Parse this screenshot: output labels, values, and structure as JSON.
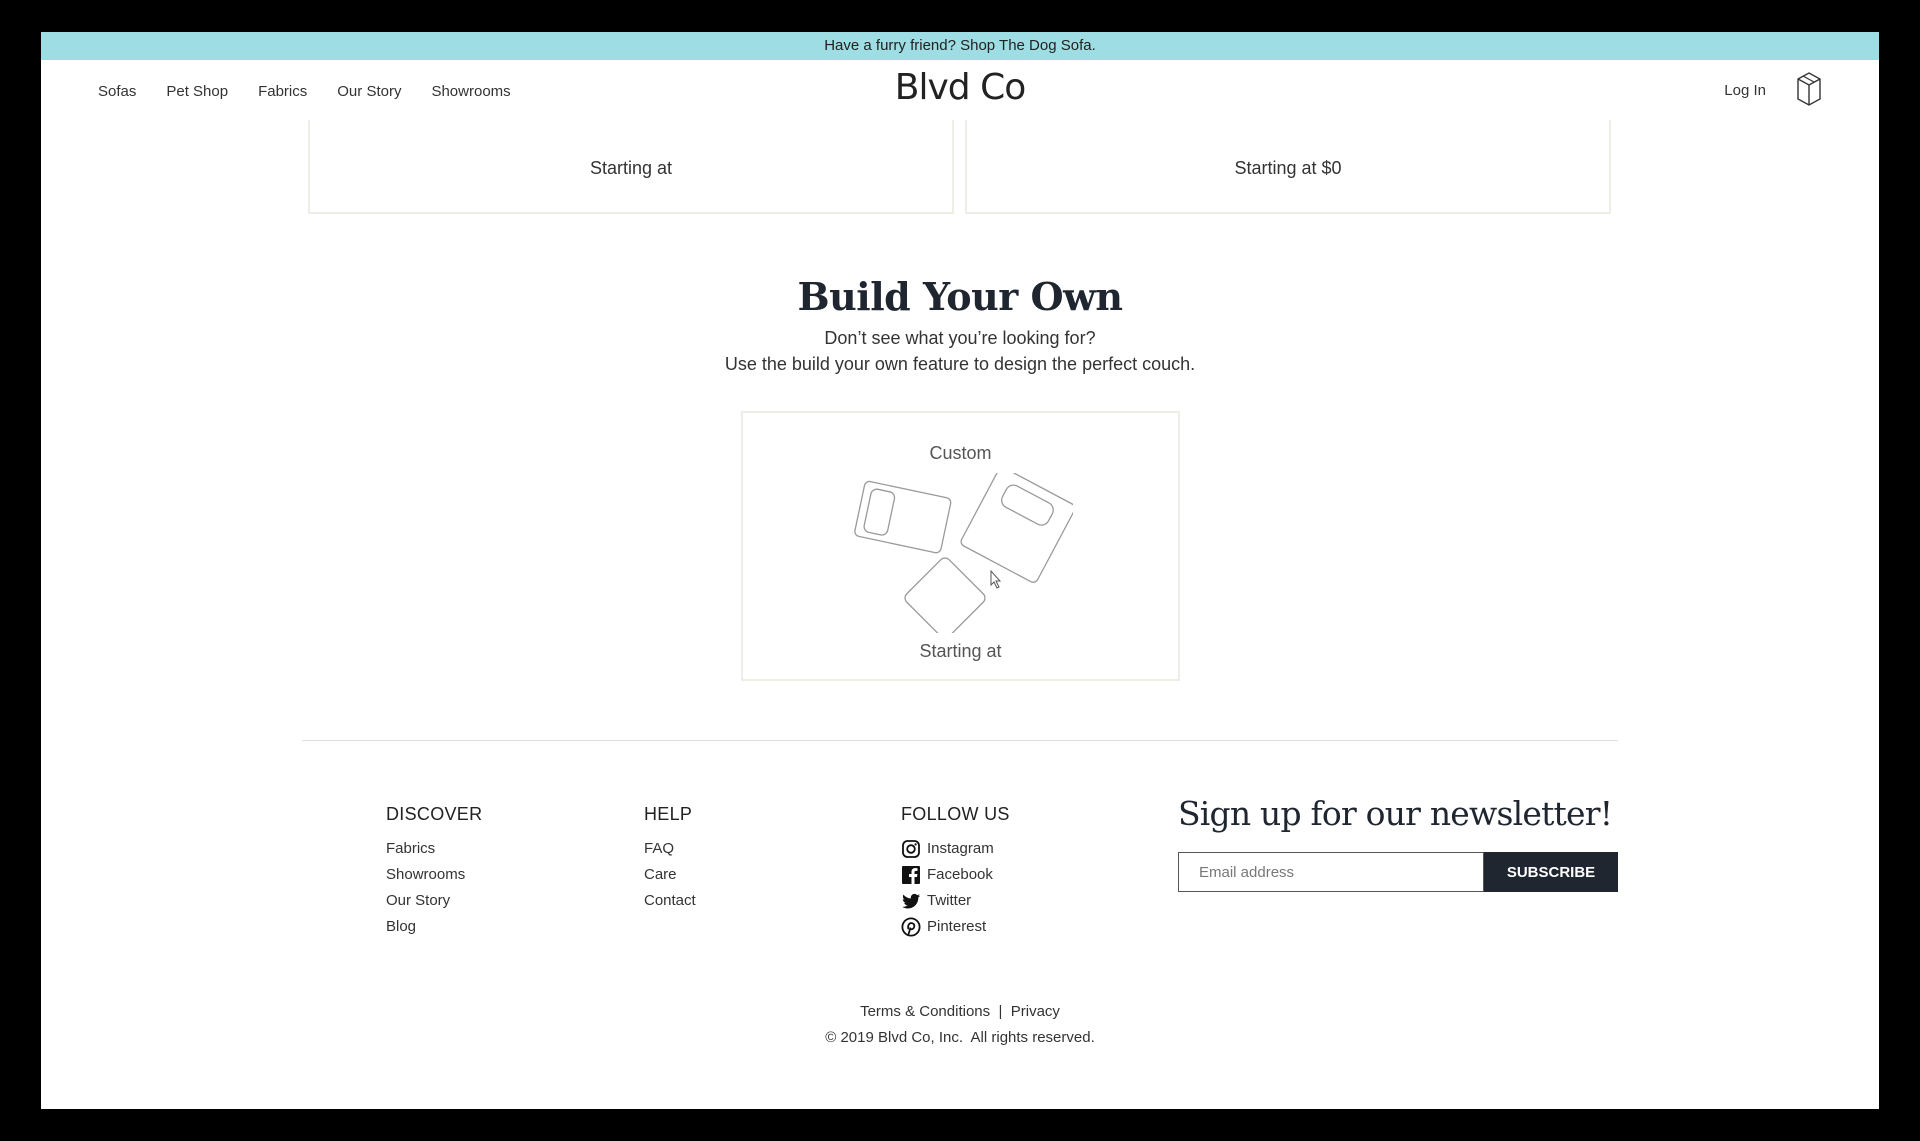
{
  "banner": {
    "text": "Have a furry friend? Shop The Dog Sofa."
  },
  "header": {
    "nav": [
      "Sofas",
      "Pet Shop",
      "Fabrics",
      "Our Story",
      "Showrooms"
    ],
    "logo": "Blvd Co",
    "login": "Log In",
    "cart_icon": "box-icon"
  },
  "products": [
    {
      "price_label": "Starting at"
    },
    {
      "price_label": "Starting at $0"
    }
  ],
  "build": {
    "title": "Build Your Own",
    "line1": "Don’t see what you’re looking for?",
    "line2": "Use the build your own feature to design the perfect couch.",
    "card_title": "Custom",
    "card_price": "Starting at"
  },
  "footer": {
    "discover": {
      "heading": "DISCOVER",
      "links": [
        "Fabrics",
        "Showrooms",
        "Our Story",
        "Blog"
      ]
    },
    "help": {
      "heading": "HELP",
      "links": [
        "FAQ",
        "Care",
        "Contact"
      ]
    },
    "follow": {
      "heading": "FOLLOW US",
      "links": [
        "Instagram",
        "Facebook",
        "Twitter",
        "Pinterest"
      ]
    },
    "newsletter": {
      "heading": "Sign up for our newsletter!",
      "placeholder": "Email address",
      "button": "SUBSCRIBE"
    },
    "legal": {
      "terms": "Terms & Conditions",
      "separator": "|",
      "privacy": "Privacy",
      "copyright": "© 2019 Blvd Co, Inc.  All rights reserved."
    }
  },
  "colors": {
    "banner": "#9ddde3",
    "dark": "#1f2630",
    "card_border": "#efeee6"
  }
}
